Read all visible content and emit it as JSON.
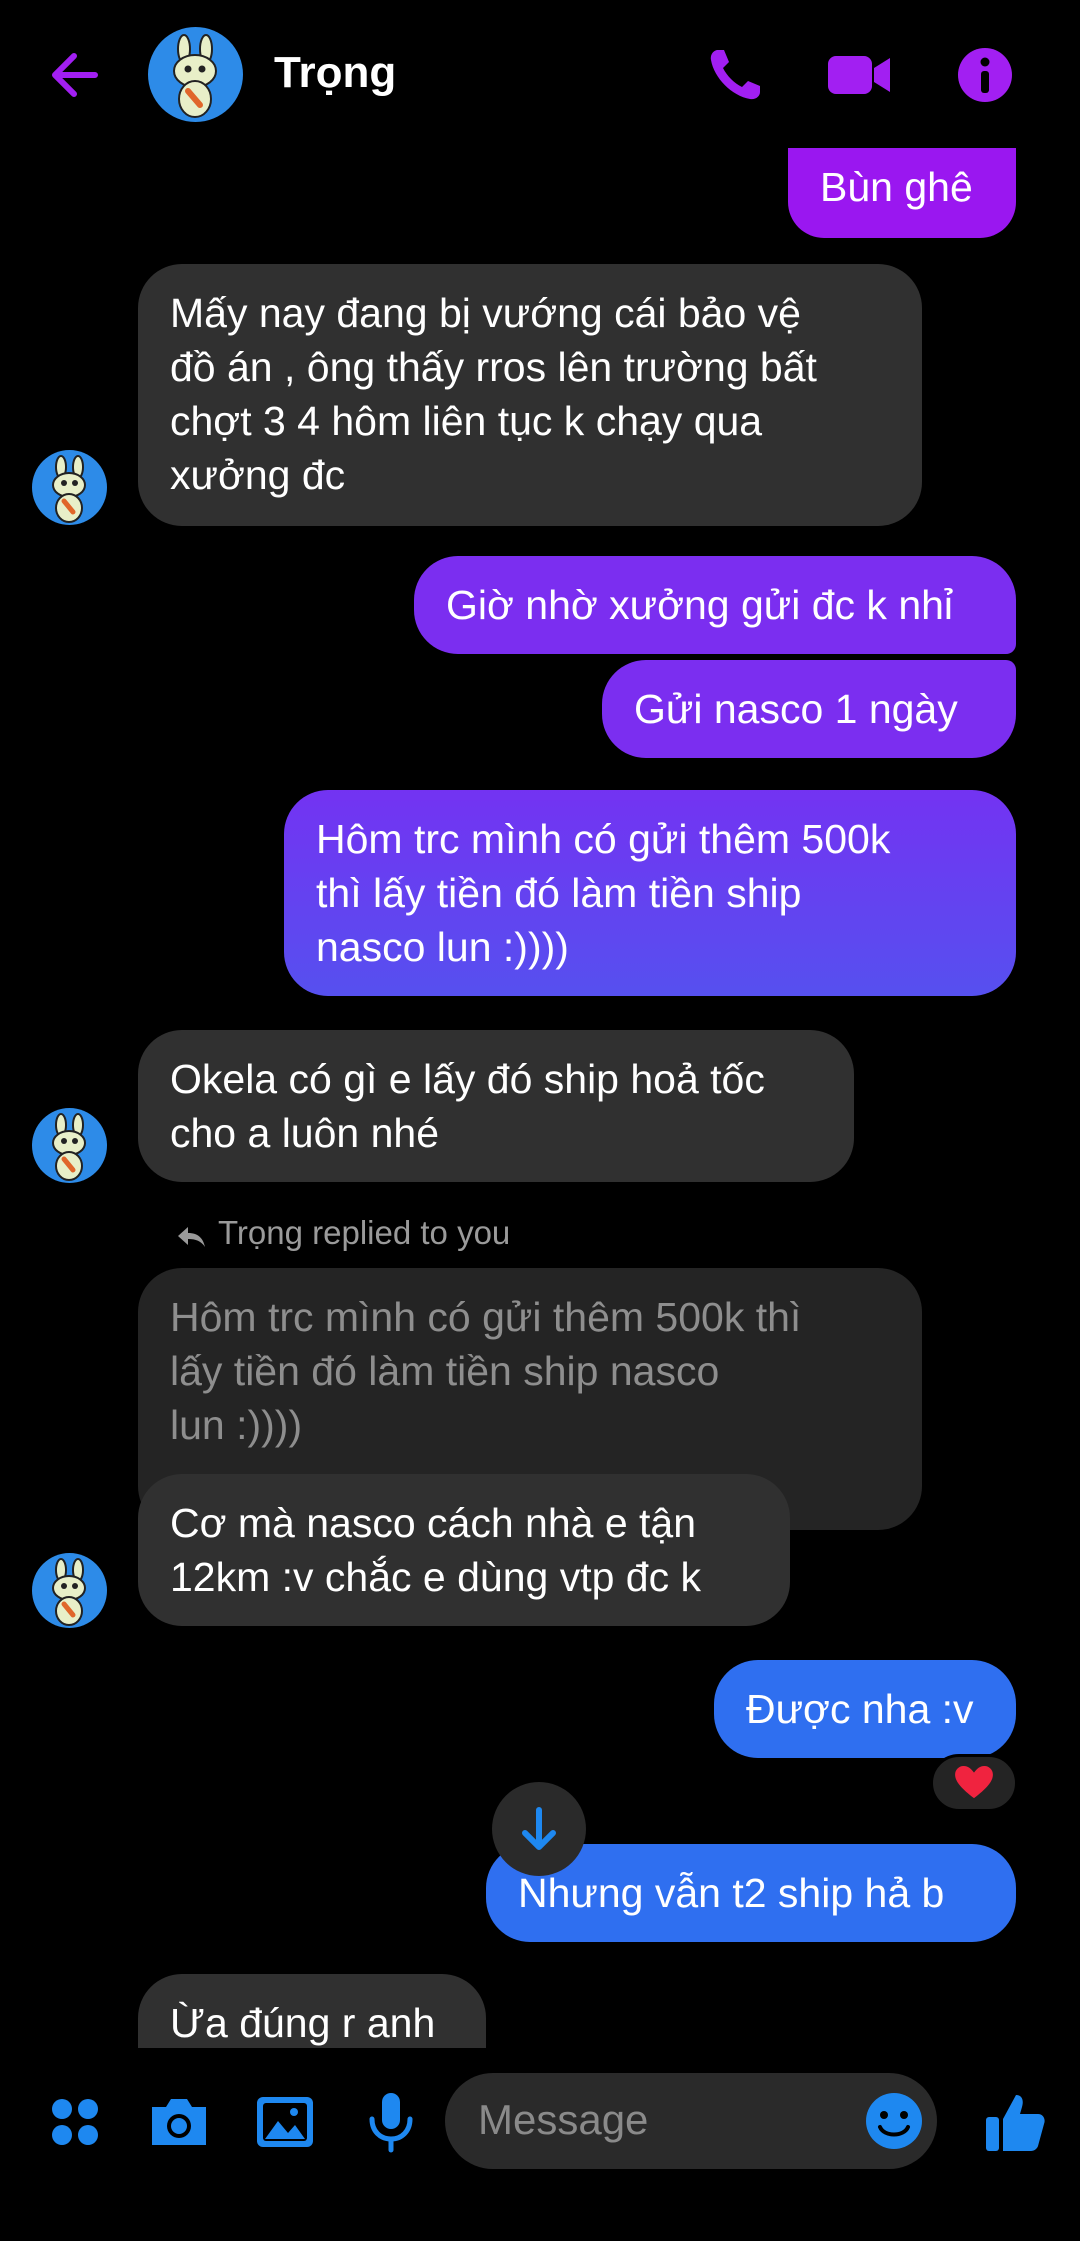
{
  "header": {
    "contact_name": "Trọng",
    "icons": [
      "back-arrow-icon",
      "phone-icon",
      "video-icon",
      "info-icon"
    ],
    "accent_color": "#9a17f0"
  },
  "messages": [
    {
      "id": "m1",
      "direction": "outgoing",
      "text": "Bùn ghê"
    },
    {
      "id": "m2",
      "direction": "incoming",
      "lines": [
        "Mấy nay đang bị vướng cái bảo vệ",
        "đồ án , ông thấy rros lên trường bất",
        "chợt 3 4 hôm liên tục k chạy qua",
        "xưởng đc"
      ]
    },
    {
      "id": "m3",
      "direction": "outgoing",
      "text": "Giờ nhờ xưởng gửi đc k nhỉ"
    },
    {
      "id": "m4",
      "direction": "outgoing",
      "text": "Gửi nasco 1 ngày"
    },
    {
      "id": "m5",
      "direction": "outgoing",
      "lines": [
        "Hôm trc mình có gửi thêm 500k",
        "thì lấy tiền đó làm tiền ship",
        "nasco lun :))))"
      ]
    },
    {
      "id": "m6",
      "direction": "incoming",
      "lines": [
        "Okela có gì e lấy đó ship hoả tốc",
        "cho a luôn nhé"
      ]
    },
    {
      "id": "m7",
      "direction": "incoming",
      "reply_label": "Trọng replied to you",
      "quoted_lines": [
        "Hôm trc mình có gửi thêm 500k thì",
        "lấy tiền đó làm tiền ship nasco",
        "lun :))))"
      ],
      "lines": [
        "Cơ mà nasco cách nhà e tận",
        "12km :v chắc e dùng vtp đc k"
      ]
    },
    {
      "id": "m8",
      "direction": "outgoing",
      "text": "Được nha :v",
      "reaction": "❤️"
    },
    {
      "id": "m9",
      "direction": "outgoing",
      "text": "Nhưng vẫn t2 ship hả b"
    },
    {
      "id": "m10",
      "direction": "incoming",
      "text": "Ừa đúng r anh"
    }
  ],
  "composer": {
    "placeholder": "Message",
    "icons": [
      "apps-icon",
      "camera-icon",
      "gallery-icon",
      "mic-icon",
      "emoji-icon",
      "thumbs-up-icon"
    ],
    "icon_color": "#1e88f0"
  }
}
